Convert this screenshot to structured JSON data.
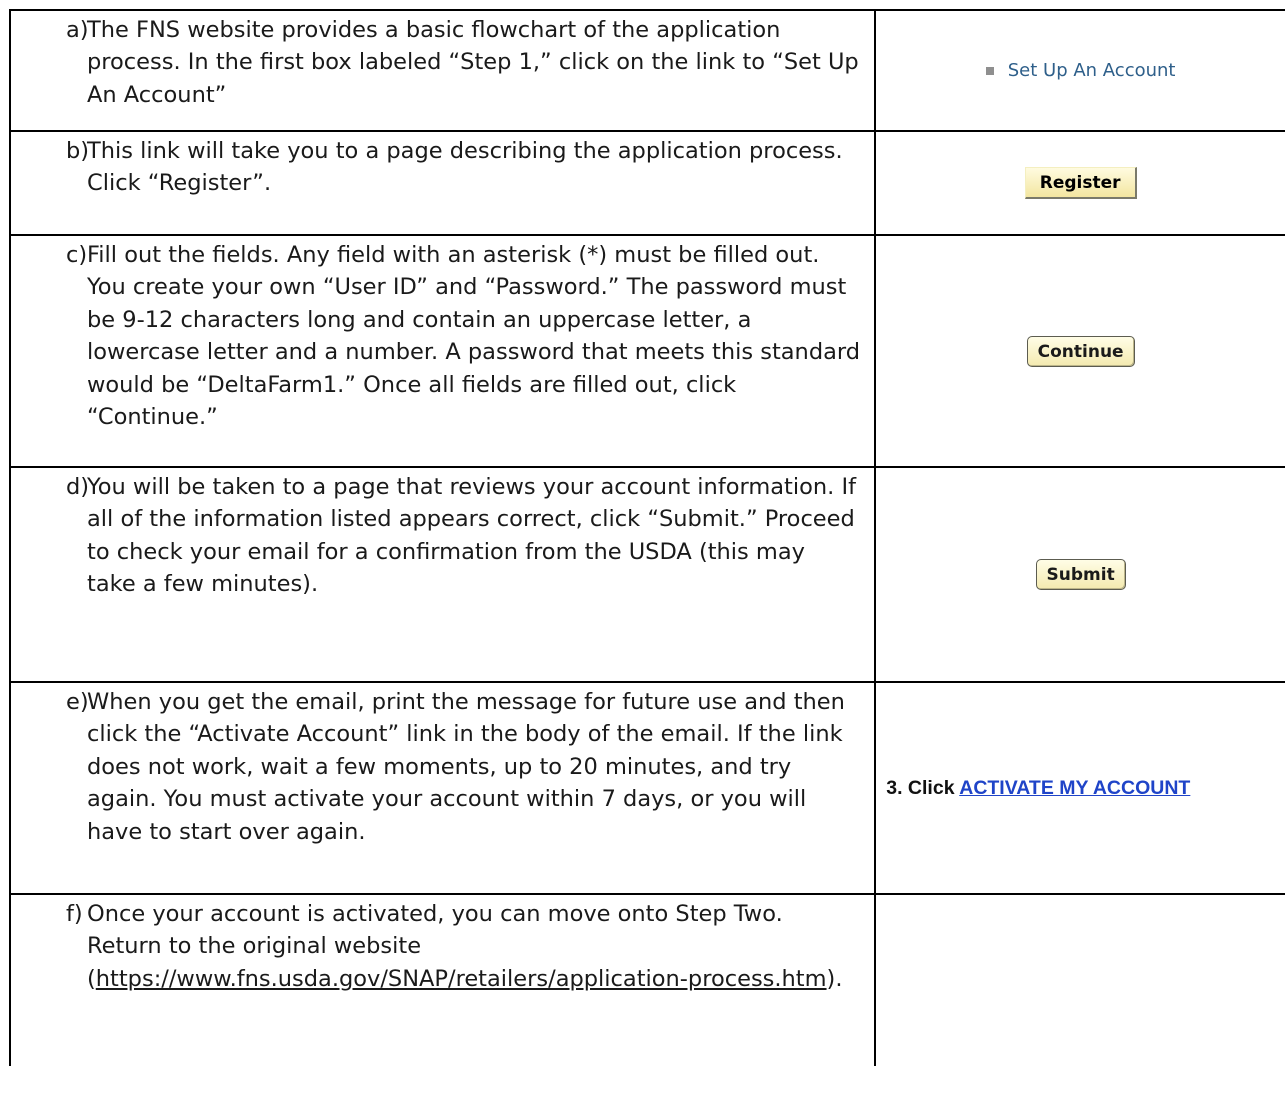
{
  "steps": [
    {
      "marker": "a)",
      "text": "The FNS website provides a basic flowchart of the application process. In the first box labeled “Step 1,” click on the link to “Set Up An Account”",
      "visual_label": "Set Up An Account"
    },
    {
      "marker": "b)",
      "text": "This link will take you to a page describing the application process. Click “Register”.",
      "visual_label": "Register"
    },
    {
      "marker": "c)",
      "text": "Fill out the fields. Any field with an asterisk (*) must be filled out. You create your own “User ID” and “Password.” The password must be 9-12 characters long and contain an uppercase letter, a lowercase letter and a number. A password that meets this standard would be “DeltaFarm1.” Once all fields are filled out, click “Continue.”",
      "visual_label": "Continue"
    },
    {
      "marker": "d)",
      "text": "You will be taken to a page that reviews your account information. If all of the information listed appears correct, click “Submit.” Proceed to check your email for a confirmation from the USDA (this may take a few minutes).",
      "visual_label": "Submit"
    },
    {
      "marker": "e)",
      "text": "When you get the email, print the message for future use and then click the “Activate Account” link in the body of the email. If the link does not work, wait a few moments, up to 20 minutes, and try again. You must activate your account within 7 days, or you will have to start over again.",
      "visual_prefix": "3.  Click ",
      "visual_link": "ACTIVATE MY ACCOUNT"
    },
    {
      "marker": "f)",
      "text_before": "Once your account is activated, you can move onto Step Two. Return to the original website (",
      "url": "https://www.fns.usda.gov/SNAP/retailers/application-process.htm",
      "text_after": ")."
    }
  ],
  "colors": {
    "link_blue": "#1f44c8",
    "setup_link": "#2e5f8a",
    "button_fill": "#f4eab0",
    "border": "#000000"
  }
}
